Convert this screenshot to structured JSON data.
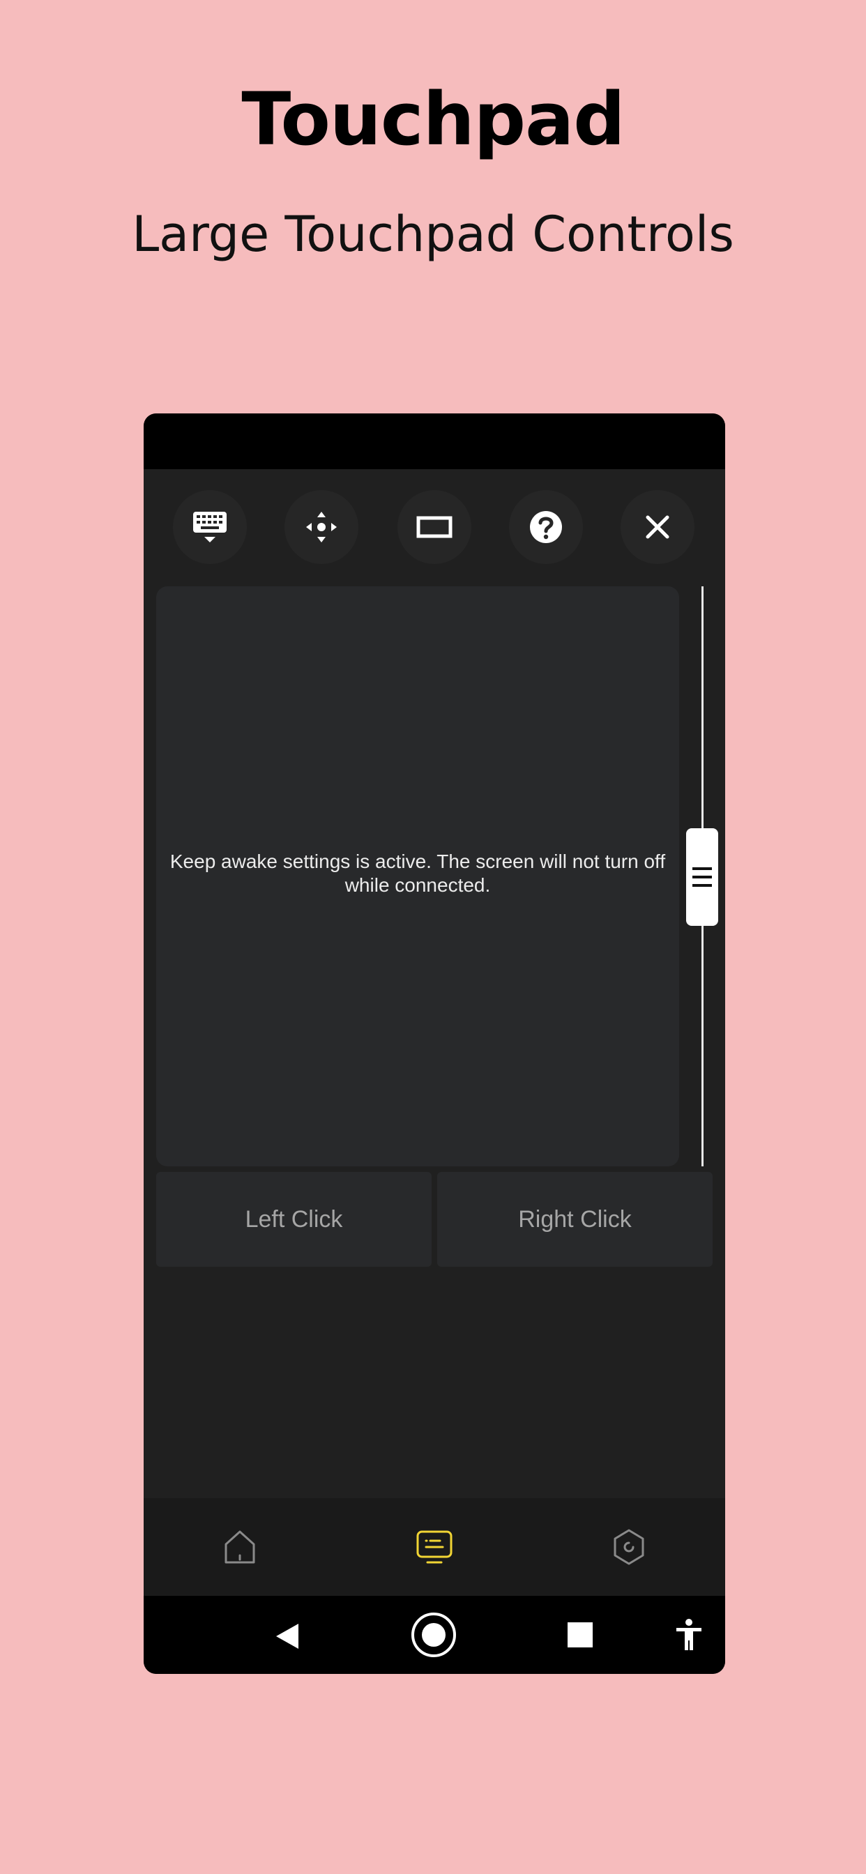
{
  "promo": {
    "title": "Touchpad",
    "subtitle": "Large Touchpad Controls"
  },
  "toolbar": {
    "icons": [
      "keyboard-icon",
      "move-icon",
      "screen-icon",
      "help-icon",
      "close-icon"
    ]
  },
  "touchpad": {
    "message": "Keep awake settings is active. The screen will not turn off while connected."
  },
  "buttons": {
    "left_click": "Left Click",
    "right_click": "Right Click"
  },
  "bottom_nav": {
    "items": [
      "home-icon",
      "remote-icon",
      "settings-icon"
    ],
    "active_color": "#f2d534",
    "inactive_color": "#8a8a8a"
  },
  "system_nav": {
    "items": [
      "back-icon",
      "home-circle-icon",
      "recents-icon",
      "accessibility-icon"
    ]
  }
}
